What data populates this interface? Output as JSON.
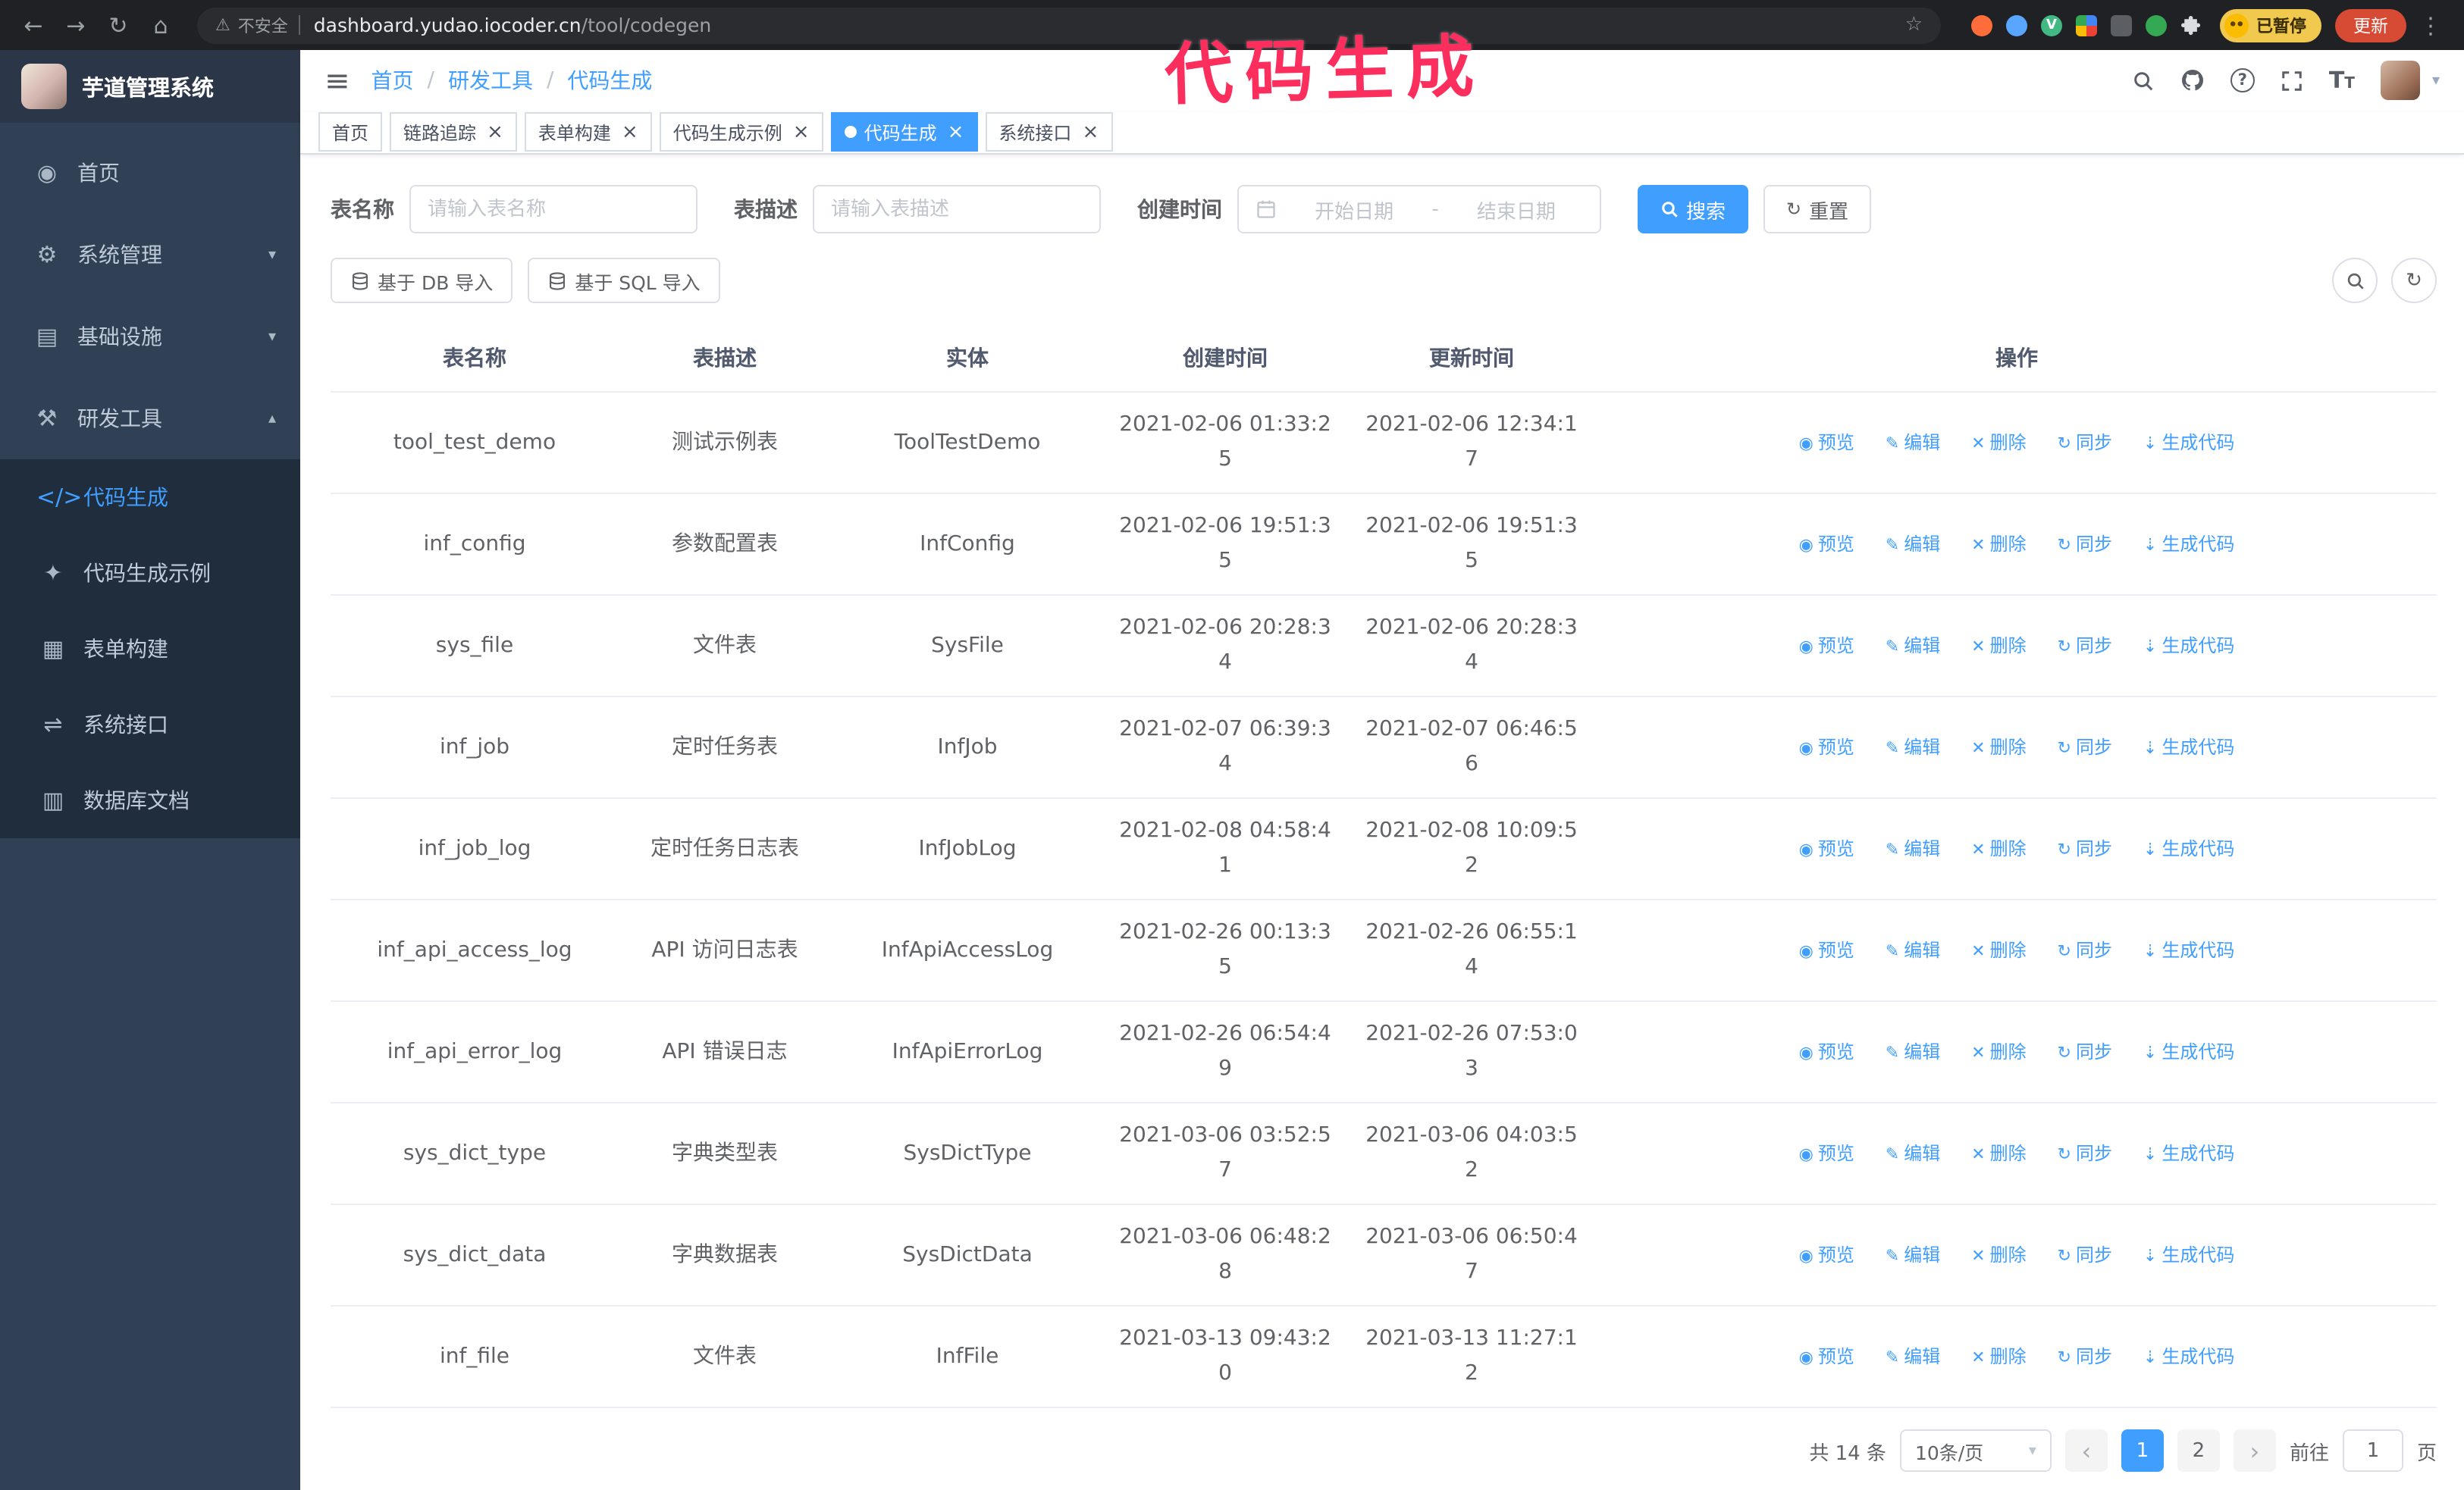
{
  "annotation": {
    "text": "代码生成",
    "color": "#fb2e5e"
  },
  "browser": {
    "security_label": "不安全",
    "url_domain": "dashboard.yudao.iocoder.cn",
    "url_path": "/tool/codegen",
    "paused_badge": "已暂停",
    "update_label": "更新"
  },
  "icons": {
    "back": "←",
    "forward": "→",
    "reload": "↻",
    "home": "⌂",
    "warning": "⚠",
    "star": "☆",
    "kebab": "⋮",
    "hamburger": "≡",
    "close": "×",
    "caret_down": "▾",
    "caret_up": "▴",
    "prev": "‹",
    "next": "›",
    "refresh": "↻",
    "question": "?",
    "vue_badge": "V"
  },
  "sidebar": {
    "app_title": "芋道管理系统",
    "items": [
      {
        "label": "首页",
        "glyph": "◉"
      },
      {
        "label": "系统管理",
        "glyph": "⚙",
        "caret": "▾"
      },
      {
        "label": "基础设施",
        "glyph": "▤",
        "caret": "▾"
      },
      {
        "label": "研发工具",
        "glyph": "⚒",
        "caret": "▴"
      }
    ],
    "subitems": [
      {
        "label": "代码生成",
        "glyph": "</>"
      },
      {
        "label": "代码生成示例",
        "glyph": "✦"
      },
      {
        "label": "表单构建",
        "glyph": "▦"
      },
      {
        "label": "系统接口",
        "glyph": "⇌"
      },
      {
        "label": "数据库文档",
        "glyph": "▥"
      }
    ]
  },
  "header": {
    "breadcrumb": [
      "首页",
      "研发工具",
      "代码生成"
    ],
    "breadcrumb_separator": "/",
    "font_size_icon_text": "T"
  },
  "tabs": [
    {
      "label": "首页",
      "closable": false,
      "active": false
    },
    {
      "label": "链路追踪",
      "closable": true,
      "active": false
    },
    {
      "label": "表单构建",
      "closable": true,
      "active": false
    },
    {
      "label": "代码生成示例",
      "closable": true,
      "active": false
    },
    {
      "label": "代码生成",
      "closable": true,
      "active": true
    },
    {
      "label": "系统接口",
      "closable": true,
      "active": false
    }
  ],
  "filters": {
    "table_name_label": "表名称",
    "table_name_placeholder": "请输入表名称",
    "table_desc_label": "表描述",
    "table_desc_placeholder": "请输入表描述",
    "create_time_label": "创建时间",
    "date_start_placeholder": "开始日期",
    "date_separator": "-",
    "date_end_placeholder": "结束日期",
    "search_label": "搜索",
    "reset_label": "重置"
  },
  "toolbar": {
    "import_db_label": "基于 DB 导入",
    "import_sql_label": "基于 SQL 导入"
  },
  "table": {
    "columns": [
      "表名称",
      "表描述",
      "实体",
      "创建时间",
      "更新时间",
      "操作"
    ],
    "op_labels": {
      "preview": "预览",
      "edit": "编辑",
      "delete": "删除",
      "sync": "同步",
      "generate": "生成代码"
    },
    "op_icons": {
      "preview": "◉",
      "edit": "✎",
      "delete": "✕",
      "sync": "↻",
      "generate": "⇣"
    },
    "rows": [
      {
        "name": "tool_test_demo",
        "desc": "测试示例表",
        "entity": "ToolTestDemo",
        "created": "2021-02-06 01:33:25",
        "updated": "2021-02-06 12:34:17"
      },
      {
        "name": "inf_config",
        "desc": "参数配置表",
        "entity": "InfConfig",
        "created": "2021-02-06 19:51:35",
        "updated": "2021-02-06 19:51:35"
      },
      {
        "name": "sys_file",
        "desc": "文件表",
        "entity": "SysFile",
        "created": "2021-02-06 20:28:34",
        "updated": "2021-02-06 20:28:34"
      },
      {
        "name": "inf_job",
        "desc": "定时任务表",
        "entity": "InfJob",
        "created": "2021-02-07 06:39:34",
        "updated": "2021-02-07 06:46:56"
      },
      {
        "name": "inf_job_log",
        "desc": "定时任务日志表",
        "entity": "InfJobLog",
        "created": "2021-02-08 04:58:41",
        "updated": "2021-02-08 10:09:52"
      },
      {
        "name": "inf_api_access_log",
        "desc": "API 访问日志表",
        "entity": "InfApiAccessLog",
        "created": "2021-02-26 00:13:35",
        "updated": "2021-02-26 06:55:14"
      },
      {
        "name": "inf_api_error_log",
        "desc": "API 错误日志",
        "entity": "InfApiErrorLog",
        "created": "2021-02-26 06:54:49",
        "updated": "2021-02-26 07:53:03"
      },
      {
        "name": "sys_dict_type",
        "desc": "字典类型表",
        "entity": "SysDictType",
        "created": "2021-03-06 03:52:57",
        "updated": "2021-03-06 04:03:52"
      },
      {
        "name": "sys_dict_data",
        "desc": "字典数据表",
        "entity": "SysDictData",
        "created": "2021-03-06 06:48:28",
        "updated": "2021-03-06 06:50:47"
      },
      {
        "name": "inf_file",
        "desc": "文件表",
        "entity": "InfFile",
        "created": "2021-03-13 09:43:20",
        "updated": "2021-03-13 11:27:12"
      }
    ]
  },
  "pagination": {
    "total_text": "共 14 条",
    "page_size_value": "10条/页",
    "pages": [
      "1",
      "2"
    ],
    "active_page": "1",
    "goto_label": "前往",
    "goto_value": "1",
    "page_unit": "页"
  }
}
